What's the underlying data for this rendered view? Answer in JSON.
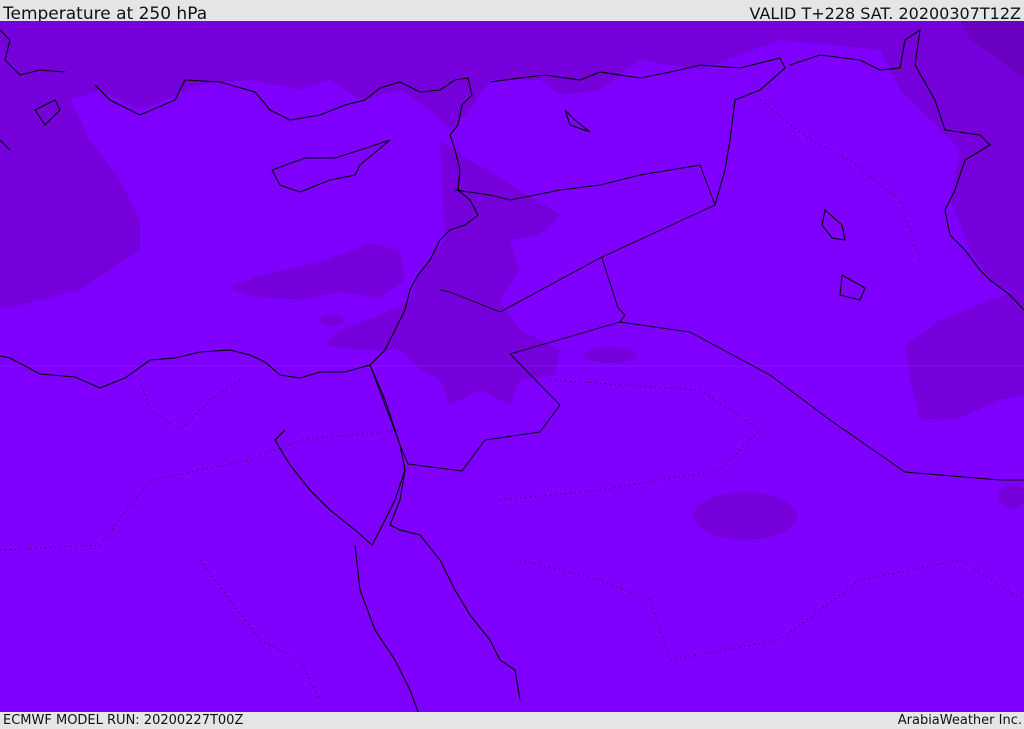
{
  "header": {
    "title": "Temperature at 250 hPa",
    "valid": "VALID T+228 SAT. 20200307T12Z"
  },
  "footer": {
    "model_run": "ECMWF MODEL RUN: 20200227T00Z",
    "brand": "ArabiaWeather Inc."
  },
  "colors": {
    "base_fill": "#7f00ff",
    "cold_fill": "#7500dc",
    "colder_fill": "#6a00c0",
    "coastline": "#000000"
  }
}
